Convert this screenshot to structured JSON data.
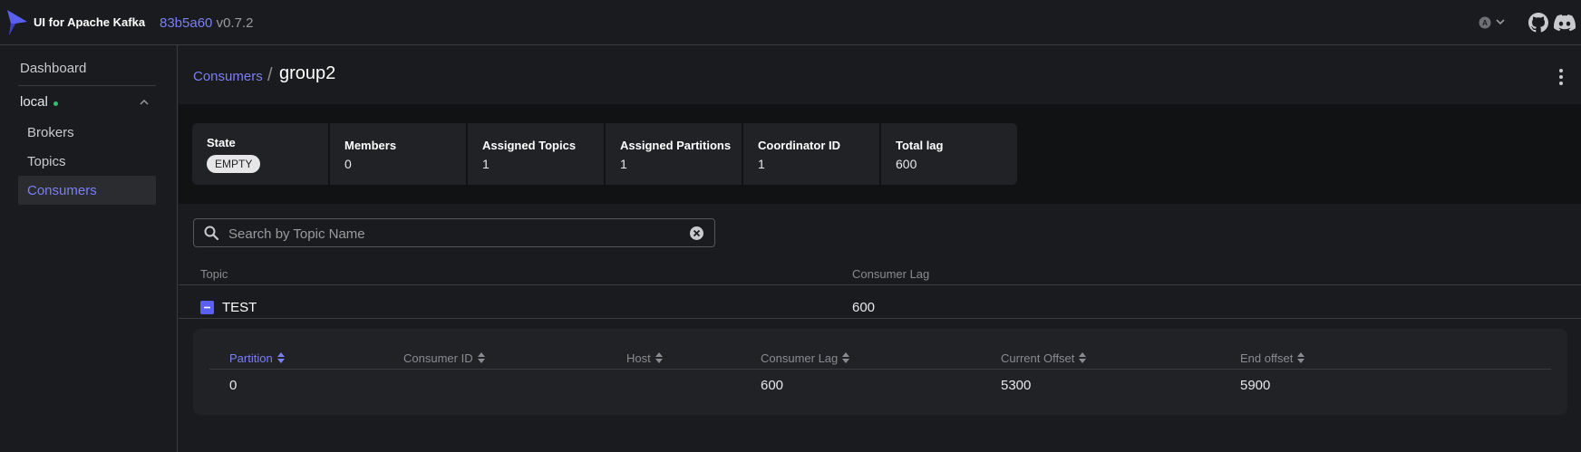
{
  "app": {
    "title": "UI for Apache Kafka",
    "version_hash": "83b5a60",
    "version": "v0.7.2",
    "accent_color": "#7b7ff5"
  },
  "sidebar": {
    "dashboard": "Dashboard",
    "cluster": "local",
    "items": [
      {
        "label": "Brokers"
      },
      {
        "label": "Topics"
      },
      {
        "label": "Consumers"
      }
    ]
  },
  "breadcrumb": {
    "parent": "Consumers",
    "separator": "/",
    "current": "group2"
  },
  "stats": [
    {
      "label": "State",
      "value": "EMPTY"
    },
    {
      "label": "Members",
      "value": "0"
    },
    {
      "label": "Assigned Topics",
      "value": "1"
    },
    {
      "label": "Assigned Partitions",
      "value": "1"
    },
    {
      "label": "Coordinator ID",
      "value": "1"
    },
    {
      "label": "Total lag",
      "value": "600"
    }
  ],
  "search": {
    "placeholder": "Search by Topic Name",
    "value": ""
  },
  "topics_table": {
    "columns": [
      "Topic",
      "Consumer Lag"
    ],
    "rows": [
      {
        "topic": "TEST",
        "consumer_lag": "600"
      }
    ]
  },
  "partitions_table": {
    "columns": [
      "Partition",
      "Consumer ID",
      "Host",
      "Consumer Lag",
      "Current Offset",
      "End offset"
    ],
    "rows": [
      {
        "partition": "0",
        "consumer_id": "",
        "host": "",
        "consumer_lag": "600",
        "current_offset": "5300",
        "end_offset": "5900"
      }
    ]
  }
}
